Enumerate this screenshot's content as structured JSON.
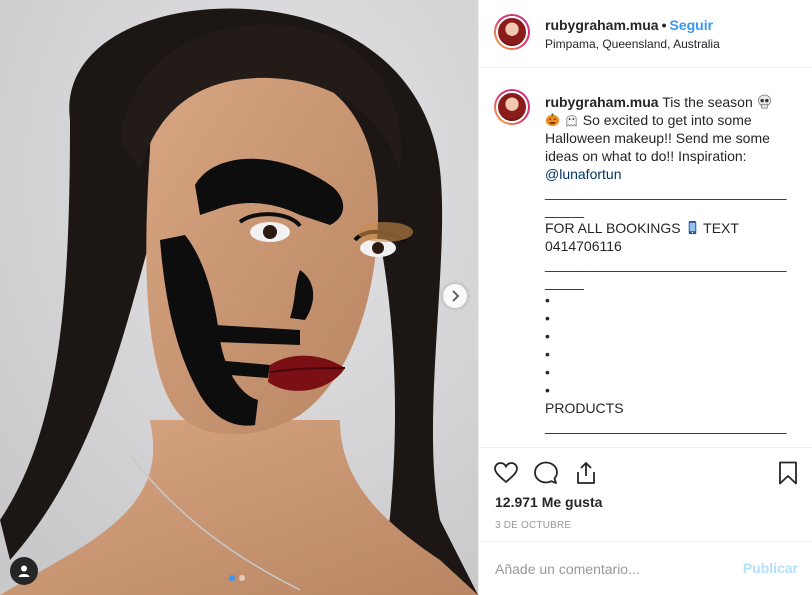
{
  "post": {
    "username": "rubygraham.mua",
    "separator": "•",
    "follow_label": "Seguir",
    "location": "Pimpama, Queensland, Australia",
    "photo_description": "makeup-portrait-half-skull",
    "carousel": {
      "total": 2,
      "current": 1
    }
  },
  "caption": {
    "username": "rubygraham.mua",
    "line1": " Tis the season ",
    "line2": " So excited to get into some Halloween makeup!! Send me some ideas on what to do!! Inspiration: ",
    "mention": "@lunafortun",
    "body": "\n____________________________________\nFOR ALL BOOKINGS ",
    "body2": " TEXT 0414706116\n____________________________________\n•\n•\n•\n•\n•\n•\nPRODUCTS\n____________________________________",
    "emojis": [
      "skull-emoji",
      "jack-o-lantern-emoji",
      "ghost-emoji",
      "mobile-phone-emoji"
    ]
  },
  "actions": {
    "icons": [
      "heart-icon",
      "comment-icon",
      "share-icon",
      "bookmark-icon"
    ],
    "likes_text": "12.971 Me gusta",
    "date_text": "3 DE OCTUBRE"
  },
  "comment": {
    "placeholder": "Añade un comentario...",
    "publish_label": "Publicar"
  },
  "colors": {
    "accent": "#3897f0",
    "publish_disabled": "#b2dffc",
    "text": "#262626",
    "muted": "#999999"
  }
}
